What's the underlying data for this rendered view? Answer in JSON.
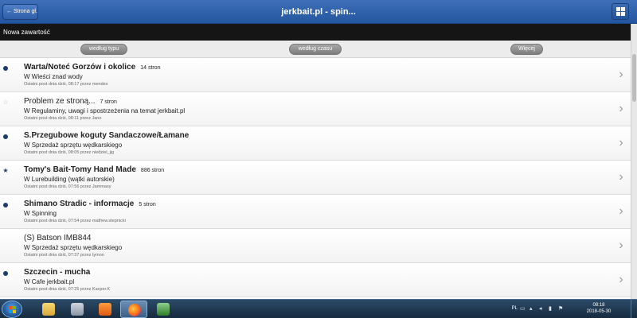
{
  "header": {
    "back_label": "← Strona gł...",
    "title": "jerkbait.pl - spin..."
  },
  "subheader": {
    "label": "Nowa zawartość"
  },
  "filters": [
    {
      "label": "według typu"
    },
    {
      "label": "według czasu"
    },
    {
      "label": "Więcej"
    }
  ],
  "items": [
    {
      "marker": "dot",
      "title": "Warta/Noteć Gorzów i okolice",
      "bold": true,
      "pages": "14 stron",
      "forum": "W Wieści znad wody",
      "meta": "Ostatni post dnia dziś, 08:17 przez mendex"
    },
    {
      "marker": "star-empty",
      "title": "Problem ze stroną...",
      "bold": false,
      "pages": "7 stron",
      "forum": "W Regulaminy, uwagi i spostrzeżenia na temat jerkbait.pl",
      "meta": "Ostatni post dnia dziś, 08:11 przez Jano"
    },
    {
      "marker": "dot",
      "title": "S.Przegubowe koguty Sandaczowe/Łamane",
      "bold": true,
      "pages": "",
      "forum": "W Sprzedaż sprzętu wędkarskiego",
      "meta": "Ostatni post dnia dziś, 08:05 przez niedziel_jig"
    },
    {
      "marker": "star-filled",
      "title": "Tomy's Bait-Tomy Hand Made",
      "bold": true,
      "pages": "886 stron",
      "forum": "W Lurebuilding (wątki autorskie)",
      "meta": "Ostatni post dnia dziś, 07:56 przez Jammasy"
    },
    {
      "marker": "dot",
      "title": "Shimano Stradic - informacje",
      "bold": true,
      "pages": "5 stron",
      "forum": "W Spinning",
      "meta": "Ostatni post dnia dziś, 07:54 przez mathew.stepnicki"
    },
    {
      "marker": "none",
      "title": "(S) Batson IMB844",
      "bold": false,
      "pages": "",
      "forum": "W Sprzedaż sprzętu wędkarskiego",
      "meta": "Ostatni post dnia dziś, 07:37 przez tymon"
    },
    {
      "marker": "dot",
      "title": "Szczecin - mucha",
      "bold": true,
      "pages": "",
      "forum": "W Cafe jerkbait.pl",
      "meta": "Ostatni post dnia dziś, 07:25 przez Kacper.K"
    }
  ],
  "taskbar": {
    "lang": "PL",
    "time": "08:18",
    "date": "2018-05-30"
  }
}
